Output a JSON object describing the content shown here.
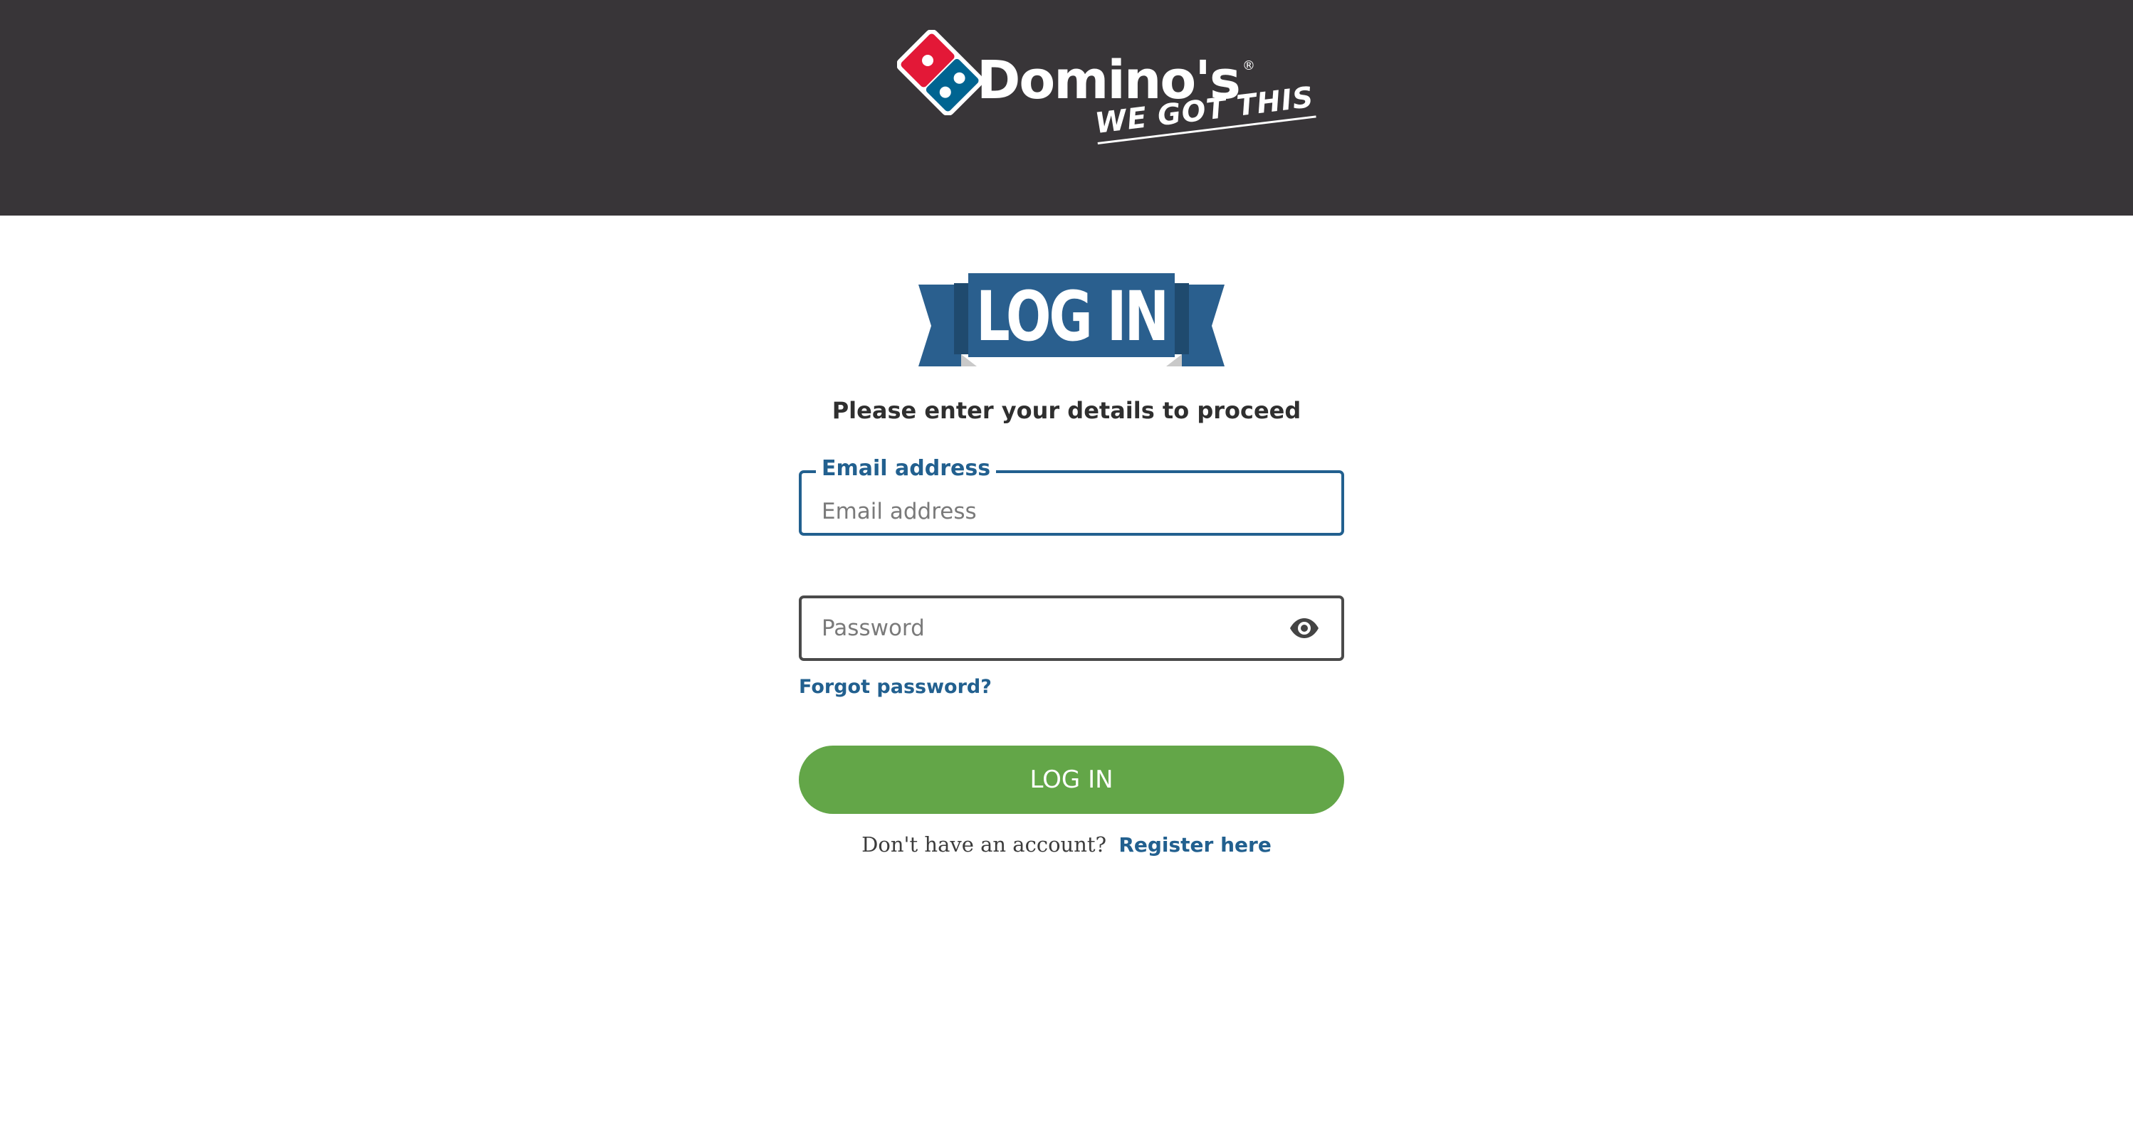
{
  "header": {
    "brand": "Domino's",
    "registered_mark": "®",
    "tagline": "WE GOT THIS",
    "background_color": "#383538"
  },
  "banner": {
    "title": "LOG IN",
    "color": "#2a5f8e"
  },
  "form": {
    "subtitle": "Please enter your details to proceed",
    "email": {
      "label": "Email address",
      "placeholder": "Email address",
      "value": ""
    },
    "password": {
      "placeholder": "Password",
      "value": "",
      "toggle_icon": "eye-icon"
    },
    "forgot_password_label": "Forgot password?",
    "submit_label": "LOG IN",
    "submit_color": "#63a648",
    "register_prompt": "Don't have an account?",
    "register_link_label": "Register here",
    "link_color": "#22608f"
  }
}
